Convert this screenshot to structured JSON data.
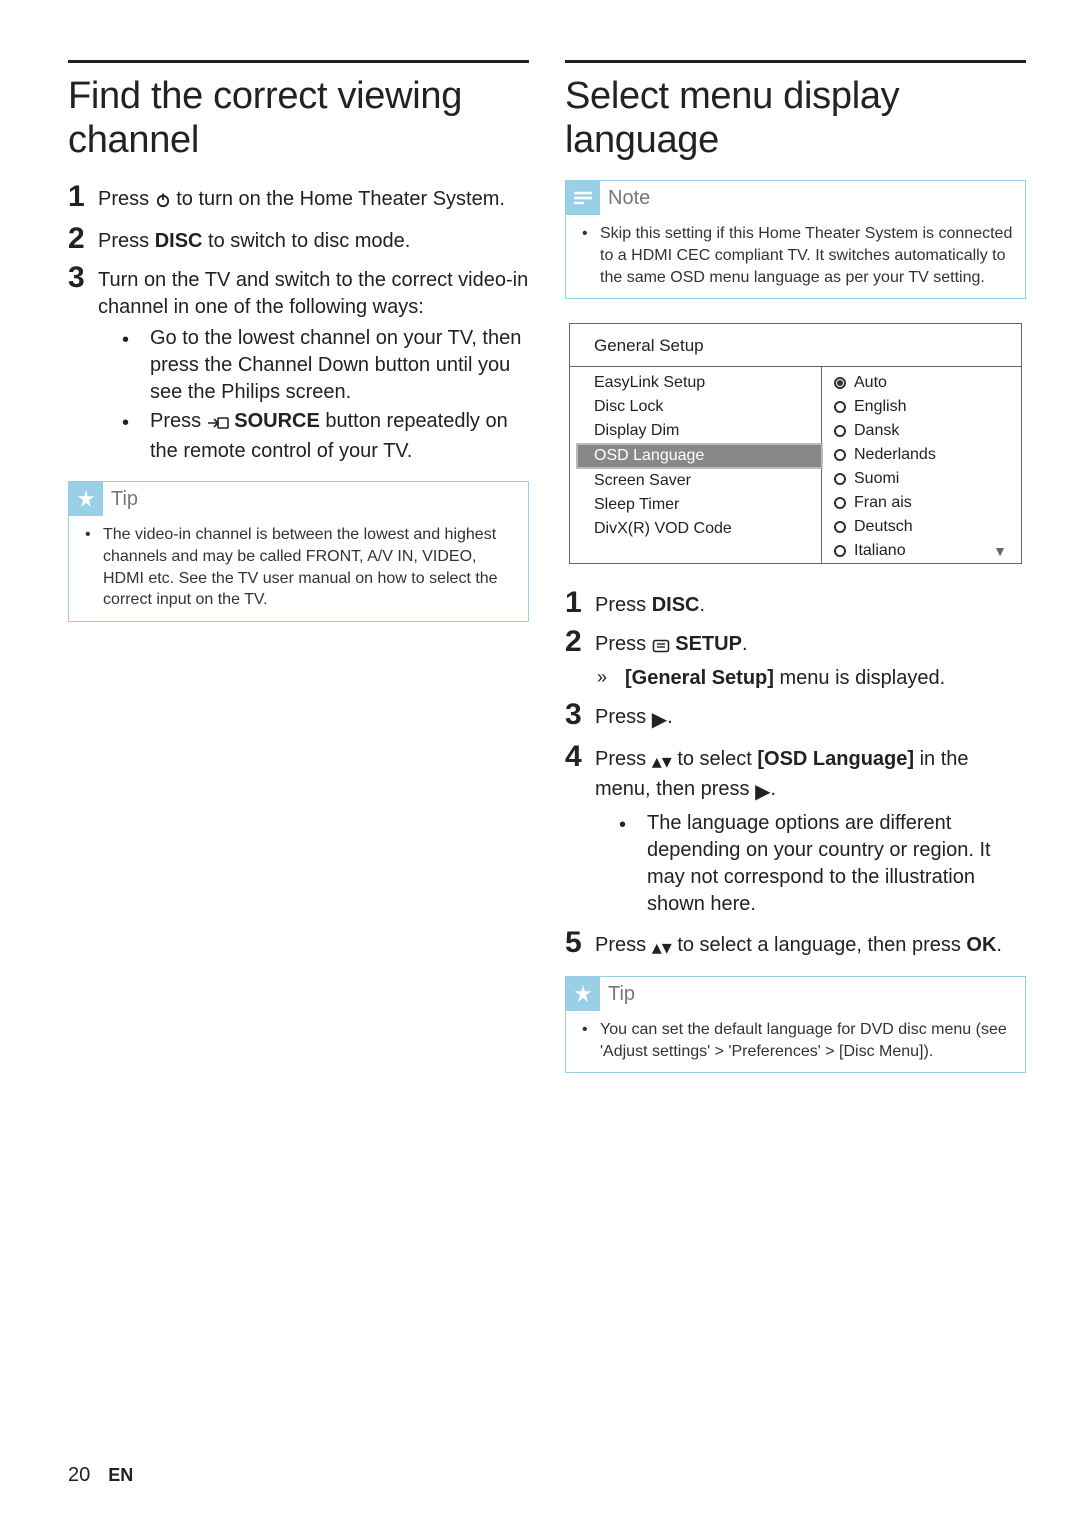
{
  "left": {
    "heading": "Find the correct viewing channel",
    "steps": [
      {
        "pre": "Press ",
        "icon": "power-icon",
        "post": " to turn on the Home Theater System."
      },
      {
        "pre": "Press ",
        "strong": "DISC",
        "post": " to switch to disc mode."
      },
      {
        "pre": "Turn on the TV and switch to the correct video-in channel in one of the following ways:",
        "subs": [
          {
            "text": "Go to the lowest channel on your TV, then press the Channel Down button until you see the Philips screen."
          },
          {
            "pre": "Press ",
            "icon": "source-icon",
            "strong": " SOURCE",
            "post": " button repeatedly on the remote control of your TV."
          }
        ]
      }
    ],
    "tip": {
      "title": "Tip",
      "body": "The video-in channel is between the lowest and highest channels and may be called FRONT, A/V IN, VIDEO, HDMI etc. See the TV user manual on how to select the correct input on the TV."
    }
  },
  "right": {
    "heading": "Select menu display language",
    "note": {
      "title": "Note",
      "body": "Skip this setting if this Home Theater System is connected to a HDMI CEC compliant TV. It switches automatically to the same OSD menu language as per your TV setting."
    },
    "menu": {
      "title": "General Setup",
      "left": [
        "EasyLink Setup",
        "Disc Lock",
        "Display Dim",
        "OSD Language",
        "Screen Saver",
        "Sleep Timer",
        "DivX(R) VOD Code"
      ],
      "selectedLeft": "OSD Language",
      "right": [
        {
          "label": "Auto",
          "selected": true
        },
        {
          "label": "English",
          "selected": false
        },
        {
          "label": "Dansk",
          "selected": false
        },
        {
          "label": "Nederlands",
          "selected": false
        },
        {
          "label": "Suomi",
          "selected": false
        },
        {
          "label": "Fran ais",
          "selected": false
        },
        {
          "label": "Deutsch",
          "selected": false
        },
        {
          "label": "Italiano",
          "selected": false
        }
      ]
    },
    "steps": [
      {
        "pre": "Press ",
        "strong": "DISC",
        "post": "."
      },
      {
        "pre": "Press ",
        "icon": "setup-icon",
        "strong": " SETUP",
        "post": ".",
        "arrow_sub": {
          "strongpre": "[General Setup]",
          "post": " menu is displayed."
        }
      },
      {
        "pre": "Press ",
        "icon": "right-arrow-icon",
        "post": "."
      },
      {
        "pre": "Press ",
        "icon": "updown-arrow-icon",
        "mid": " to select ",
        "strong": "[OSD Language]",
        "post2": " in the menu, then press ",
        "icon2": "right-arrow-icon",
        "post3": ".",
        "sub_bullet": "The language options are different depending on your country or region. It may not correspond to the illustration shown here."
      },
      {
        "pre": "Press ",
        "icon": "updown-arrow-icon",
        "mid": " to select a language, then press ",
        "strong": "OK",
        "post": "."
      }
    ],
    "tip": {
      "title": "Tip",
      "body_pre": "You can set the default language for DVD disc menu (see 'Adjust settings' > 'Preferences' > ",
      "body_strong": "[Disc Menu]",
      "body_post": ")."
    }
  },
  "footer": {
    "page": "20",
    "lang": "EN"
  }
}
